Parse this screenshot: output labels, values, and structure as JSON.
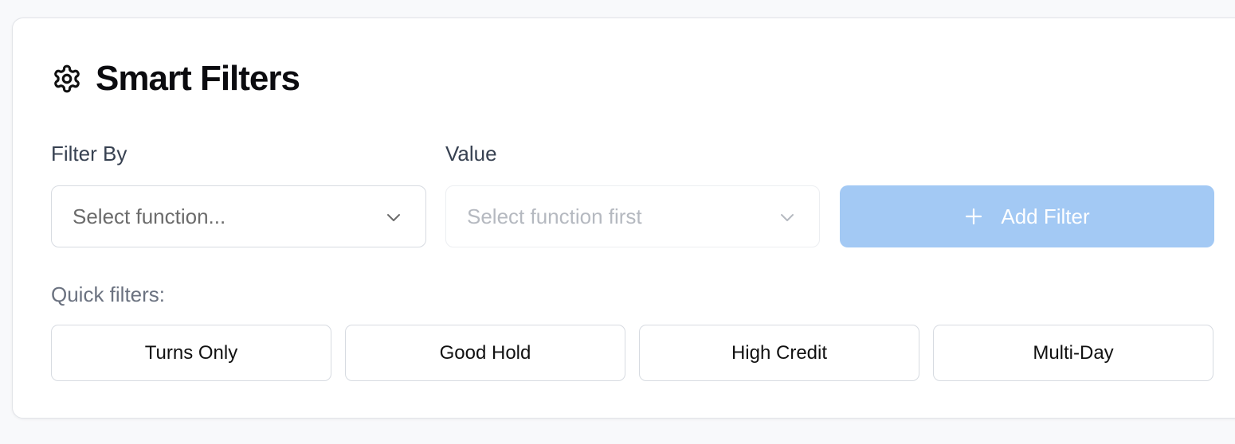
{
  "header": {
    "title": "Smart Filters",
    "icon": "gear-icon"
  },
  "filter_by": {
    "label": "Filter By",
    "placeholder": "Select function...",
    "icon": "chevron-down-icon"
  },
  "value": {
    "label": "Value",
    "placeholder": "Select function first",
    "disabled": true,
    "icon": "chevron-down-icon"
  },
  "add_filter": {
    "label": "Add Filter",
    "icon": "plus-icon",
    "disabled": true,
    "color": "#a3c9f4"
  },
  "quick_filters": {
    "label": "Quick filters:",
    "items": [
      {
        "label": "Turns Only"
      },
      {
        "label": "Good Hold"
      },
      {
        "label": "High Credit"
      },
      {
        "label": "Multi-Day"
      }
    ]
  },
  "colors": {
    "title": "#0b0b0f",
    "label": "#374151",
    "muted": "#6b7280",
    "placeholder": "#6b6b6b",
    "disabled_placeholder": "#b5b9c0",
    "border": "#d7dbe1"
  }
}
